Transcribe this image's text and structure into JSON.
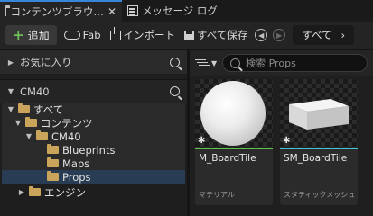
{
  "tabs": [
    {
      "label": "コンテンツブラウ…",
      "icon": "folder-icon",
      "close": "✕"
    },
    {
      "label": "メッセージ ログ",
      "icon": "message-log-icon"
    }
  ],
  "toolbar": {
    "add_label": "追加",
    "fab_label": "Fab",
    "import_label": "インポート",
    "save_all_label": "すべて保存",
    "breadcrumb": {
      "root": "すべて",
      "sep": "›"
    }
  },
  "sidebar": {
    "favorites_label": "お気に入り",
    "project_label": "CM40",
    "tree": [
      {
        "label": "すべて",
        "level": 0,
        "expanded": true
      },
      {
        "label": "コンテンツ",
        "level": 1,
        "expanded": true
      },
      {
        "label": "CM40",
        "level": 2,
        "expanded": true
      },
      {
        "label": "Blueprints",
        "level": 3
      },
      {
        "label": "Maps",
        "level": 3
      },
      {
        "label": "Props",
        "level": 3,
        "selected": true
      },
      {
        "label": "エンジン",
        "level": 1,
        "expanded": false
      }
    ]
  },
  "content": {
    "search_placeholder": "検索 Props",
    "assets": [
      {
        "name": "M_BoardTile",
        "type": "マテリアル",
        "underline_color": "#5fbf4f",
        "thumb": "sphere"
      },
      {
        "name": "SM_BoardTile",
        "type": "スタティックメッシュ",
        "underline_color": "#3fc6d6",
        "thumb": "box"
      }
    ]
  },
  "colors": {
    "accent": "#3a86d6",
    "selection": "#283c53",
    "folder": "#c9a45a"
  }
}
